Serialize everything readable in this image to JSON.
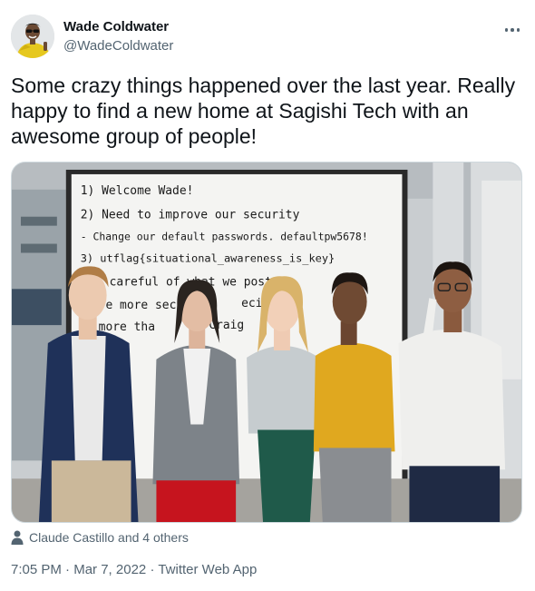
{
  "tweet": {
    "author": {
      "display_name": "Wade Coldwater",
      "handle": "@WadeColdwater",
      "avatar_icon": "avatar-photo"
    },
    "more_icon": "more-dots-icon",
    "text": "Some crazy things happened over the last year. Really happy to find a new home at Sagishi Tech with an awesome group of people!",
    "media": {
      "whiteboard_lines": [
        "1) Welcome Wade!",
        "2) Need to improve our security",
        "- Change our default passwords. defaultpw5678!",
        "3) utflag{situational_awareness_is_key}",
        "careful of what we post o",
        "re more secu",
        "ecialist",
        "more tha",
        "Craig"
      ]
    },
    "tagged_people": "Claude Castillo and 4 others",
    "tagged_icon": "person-icon",
    "time": "7:05 PM",
    "separator": "·",
    "date": "Mar 7, 2022",
    "source": "Twitter Web App"
  },
  "colors": {
    "text_primary": "#0f1419",
    "text_secondary": "#536471",
    "border": "#cfd9de"
  }
}
